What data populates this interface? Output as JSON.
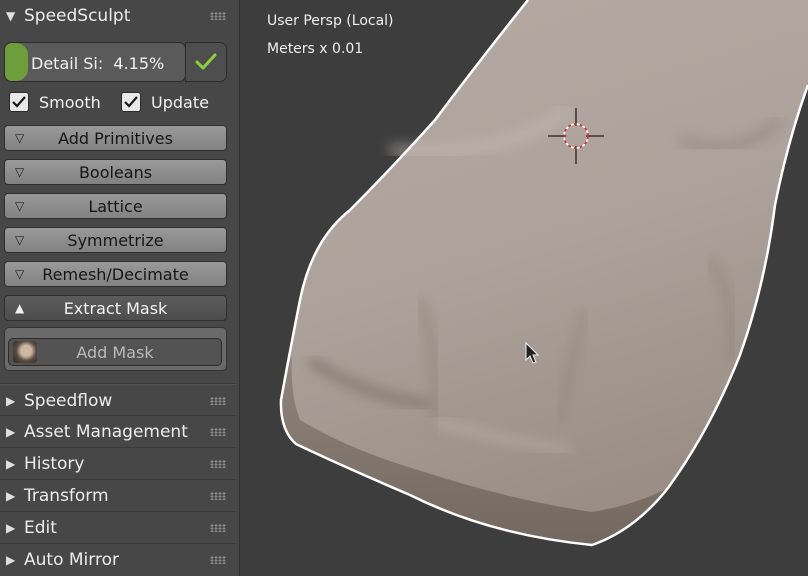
{
  "speedsculpt": {
    "title": "SpeedSculpt",
    "detail_label": "Detail Si:",
    "detail_value": "4.15%",
    "detail_fraction": 0.0415,
    "smooth_label": "Smooth",
    "smooth_checked": true,
    "update_label": "Update",
    "update_checked": true,
    "subpanels": [
      {
        "label": "Add Primitives"
      },
      {
        "label": "Booleans"
      },
      {
        "label": "Lattice"
      },
      {
        "label": "Symmetrize"
      },
      {
        "label": "Remesh/Decimate"
      },
      {
        "label": "Extract Mask"
      }
    ],
    "add_mask_label": "Add Mask"
  },
  "panels": [
    {
      "label": "Speedflow"
    },
    {
      "label": "Asset Management"
    },
    {
      "label": "History"
    },
    {
      "label": "Transform"
    },
    {
      "label": "Edit"
    },
    {
      "label": "Auto Mirror"
    }
  ],
  "viewport": {
    "view_name": "User Persp (Local)",
    "units": "Meters x 0.01"
  },
  "colors": {
    "accent_green": "#6e9d3c",
    "checkmark_green": "#8ad13b",
    "mesh": "#b3a8a1",
    "outline": "#ffffff"
  },
  "icons": [
    "triangle-down-icon",
    "triangle-right-icon",
    "triangle-up-icon",
    "checkmark-icon",
    "drag-grip-icon",
    "3d-cursor-icon",
    "mouse-pointer-icon"
  ]
}
